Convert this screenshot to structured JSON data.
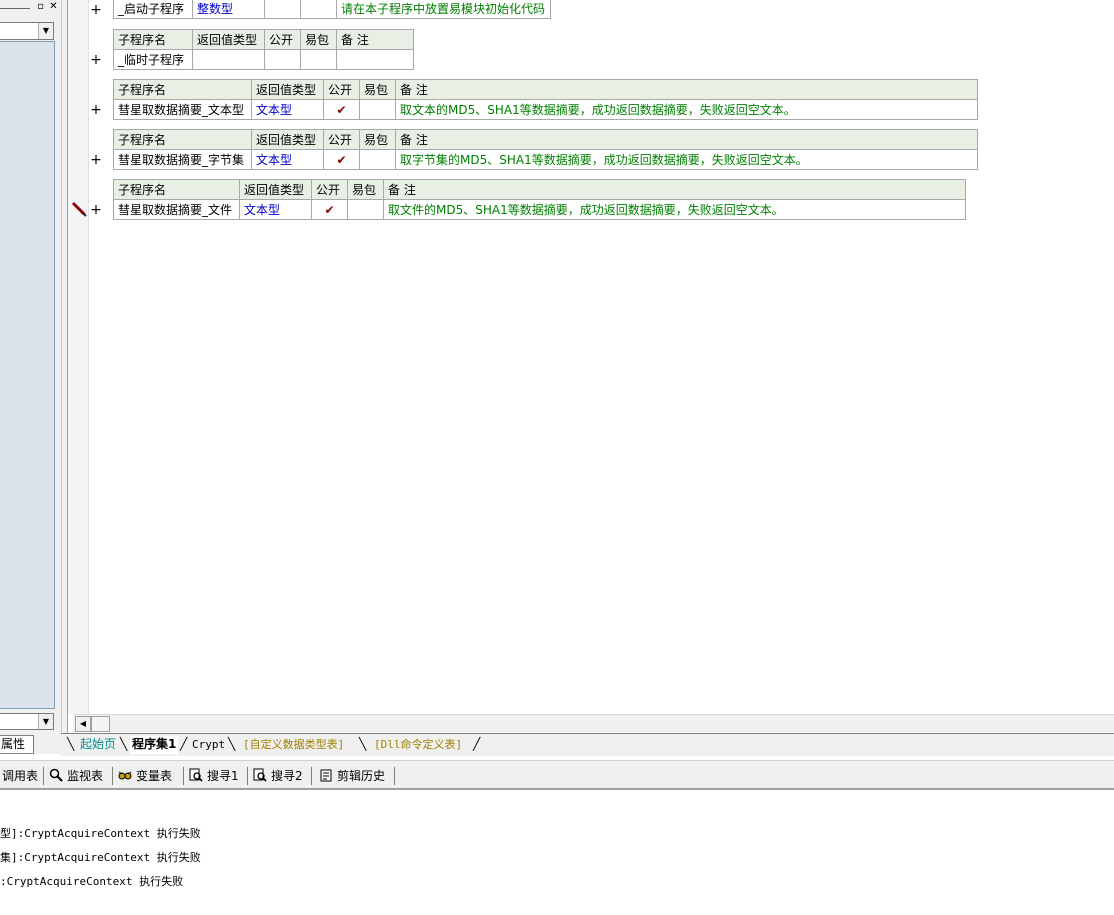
{
  "left_panel": {
    "bottom_tab_label": "属性"
  },
  "header_labels": {
    "name": "子程序名",
    "return_type": "返回值类型",
    "public": "公开",
    "easy_pack": "易包",
    "remark": "备 注"
  },
  "subs": [
    {
      "name": "_启动子程序",
      "return_type": "整数型",
      "public": "",
      "easy_pack": "",
      "remark": "请在本子程序中放置易模块初始化代码"
    },
    {
      "name": "_临时子程序",
      "return_type": "",
      "public": "",
      "easy_pack": "",
      "remark": ""
    },
    {
      "name": "彗星取数据摘要_文本型",
      "return_type": "文本型",
      "public": "✔",
      "easy_pack": "",
      "remark": "取文本的MD5、SHA1等数据摘要，成功返回数据摘要，失败返回空文本。"
    },
    {
      "name": "彗星取数据摘要_字节集",
      "return_type": "文本型",
      "public": "✔",
      "easy_pack": "",
      "remark": "取字节集的MD5、SHA1等数据摘要，成功返回数据摘要，失败返回空文本。"
    },
    {
      "name": "彗星取数据摘要_文件",
      "return_type": "文本型",
      "public": "✔",
      "easy_pack": "",
      "remark": "取文件的MD5、SHA1等数据摘要，成功返回数据摘要，失败返回空文本。"
    }
  ],
  "expand_symbol": "+",
  "file_tabs": [
    "起始页",
    "程序集1",
    "Crypt",
    "[自定义数据类型表]",
    "[Dll命令定义表]"
  ],
  "toolbar": {
    "items": [
      "调用表",
      "监视表",
      "变量表",
      "搜寻1",
      "搜寻2",
      "剪辑历史"
    ]
  },
  "output_lines": [
    "型]:CryptAcquireContext 执行失败",
    "集]:CryptAcquireContext 执行失败",
    ":CryptAcquireContext 执行失败"
  ]
}
